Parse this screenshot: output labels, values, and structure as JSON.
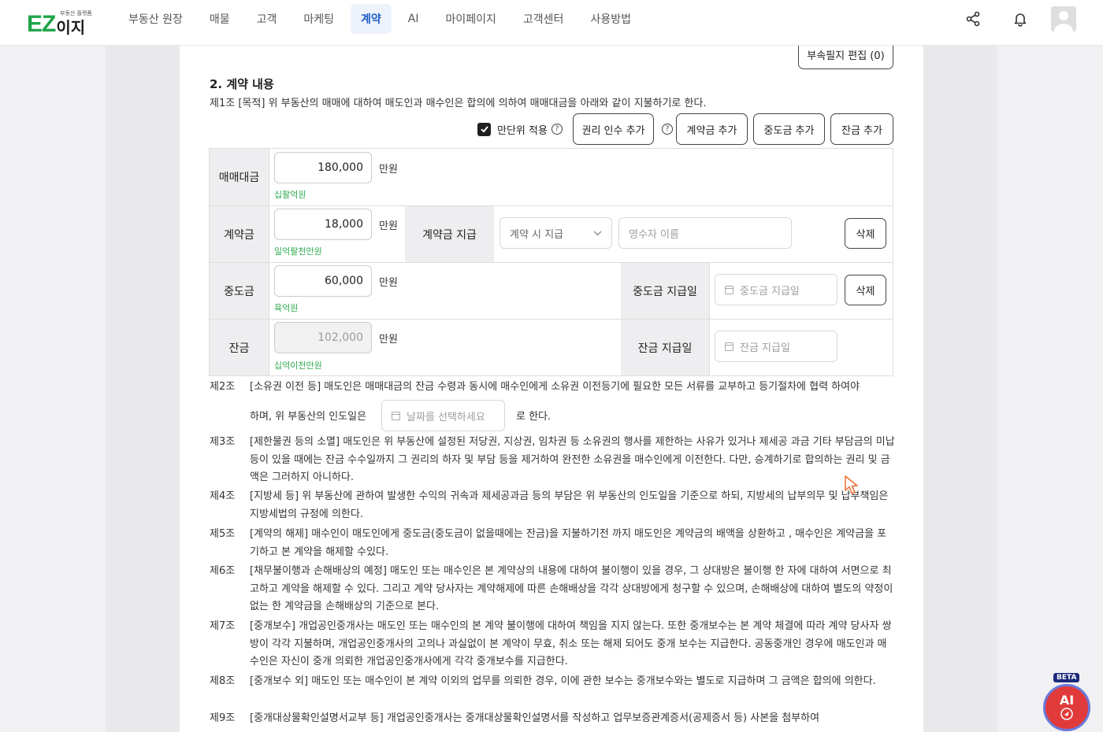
{
  "logo": {
    "text": "EZ",
    "text2": "이지",
    "sub": "부동산 플랫폼"
  },
  "nav": {
    "items": [
      "부동산 원장",
      "매물",
      "고객",
      "마케팅",
      "계약",
      "AI",
      "마이페이지",
      "고객센터",
      "사용방법"
    ],
    "active": "계약"
  },
  "toolbar": {
    "attach_edit": "부속필지 편집 (0)"
  },
  "section": {
    "title": "2. 계약 내용",
    "article1": "제1조 [목적] 위 부동산의 매매에 대하여 매도인과 매수인은 합의에 의하여 매매대금을 아래와 같이 지불하기로 한다."
  },
  "options": {
    "manwon_label": "만단위 적용",
    "manwon_checked": true,
    "rights_btn": "권리 인수 추가",
    "deposit_btn": "계약금 추가",
    "middle_btn": "중도금 추가",
    "balance_btn": "잔금 추가"
  },
  "table": {
    "sale_price": {
      "label": "매매대금",
      "value": "180,000",
      "unit": "만원",
      "korean": "십팔억원"
    },
    "deposit": {
      "label": "계약금",
      "value": "18,000",
      "unit": "만원",
      "korean": "일억팔천만원",
      "pay_label": "계약금 지급",
      "pay_select": "계약 시 지급",
      "receiver_placeholder": "영수자 이름",
      "delete": "삭제"
    },
    "middle": {
      "label": "중도금",
      "value": "60,000",
      "unit": "만원",
      "korean": "육억원",
      "date_label": "중도금 지급일",
      "date_placeholder": "중도금 지급일",
      "delete": "삭제"
    },
    "balance": {
      "label": "잔금",
      "value": "102,000",
      "unit": "만원",
      "korean": "십억이천만원",
      "date_label": "잔금 지급일",
      "date_placeholder": "잔금 지급일"
    }
  },
  "clauses": [
    {
      "num": "제2조",
      "text": "[소유권 이전 등] 매도인은 매매대금의 잔금 수령과 동시에 매수인에게 소유권 이전등기에 필요한 모든 서류를 교부하고 등기절차에 협력 하여야",
      "text2a": "하며, 위 부동산의 인도일은",
      "date_placeholder": "날짜를 선택하세요",
      "text2b": "로 한다."
    },
    {
      "num": "제3조",
      "text": "[제한물권 등의 소멸] 매도인은 위 부동산에 설정된 저당권, 지상권, 임차권 등 소유권의 행사를 제한하는 사유가 있거나 제세공 과금 기타 부담금의 미납 등이 있을 때에는 잔금 수수일까지 그 권리의 하자 및 부담 등을 제거하여 완전한 소유권을 매수인에게 이전한다. 다만, 승계하기로 합의하는 권리 및 금액은 그러하지 아니하다."
    },
    {
      "num": "제4조",
      "text": "[지방세 등] 위 부동산에 관하여 발생한 수익의 귀속과 제세공과금 등의 부담은 위 부동산의 인도일을 기준으로 하되, 지방세의 납부의무 및 납부책임은 지방세법의 규정에 의한다."
    },
    {
      "num": "제5조",
      "text": "[계약의 해제] 매수인이 매도인에게 중도금(중도금이 없을때에는 잔금)을 지불하기전 까지 매도인은 계약금의 배액을 상환하고 , 매수인은 계약금을 포기하고 본 계약을 해제할 수있다."
    },
    {
      "num": "제6조",
      "text": "[채무불이행과 손해배상의 예정] 매도인 또는 매수인은 본 계약상의 내용에 대하여 불이행이 있을 경우, 그 상대방은 불이행 한 자에 대하여 서면으로 최고하고 계약을 해제할 수 있다. 그리고 계약 당사자는 계약해제에 따른 손해배상을 각각 상대방에게 청구할 수 있으며, 손해배상에 대하여 별도의 약정이 없는 한 계약금을 손해배상의 기준으로 본다."
    },
    {
      "num": "제7조",
      "text": "[중개보수] 개업공인중개사는 매도인 또는 매수인의 본 계약 불이행에 대하여 책임을 지지 않는다. 또한 중개보수는 본 계약 체결에 따라 계약 당사자 쌍방이 각각 지불하며, 개업공인중개사의 고의나 과실없이 본 계약이 무효, 취소 또는 해제 되어도 중개 보수는 지급한다. 공동중개인 경우에 매도인과 매수인은 자신이 중개 의뢰한 개업공인중개사에게 각각 중개보수를 지급한다."
    },
    {
      "num": "제8조",
      "text": "[중개보수 외] 매도인 또는 매수인이 본 계약 이외의 업무를 의뢰한 경우, 이에 관한 보수는 중개보수와는 별도로 지급하며 그 금액은 합의에 의한다."
    },
    {
      "num": "제9조",
      "text": "[중개대상물확인설명서교부 등] 개업공인중개사는 중개대상물확인설명서를 작성하고 업무보증관계증서(공제증서 등) 사본을 첨부하여"
    }
  ],
  "ai_fab": {
    "label": "AI",
    "badge": "BETA"
  },
  "colors": {
    "accent": "#1a5cc8",
    "brand": "#21a44a",
    "korean_amount": "#2faa4f"
  }
}
